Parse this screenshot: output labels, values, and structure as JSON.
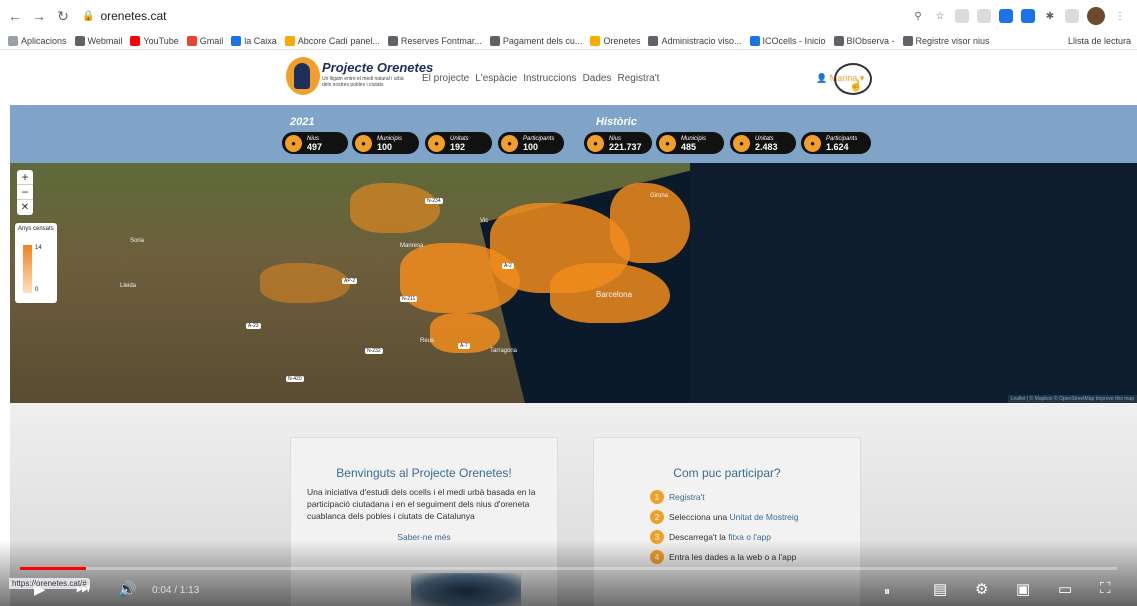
{
  "browser": {
    "url": "orenetes.cat",
    "bookmarks": [
      "Aplicacions",
      "Webmail",
      "YouTube",
      "Gmail",
      "la Caixa",
      "Abcore Cadí panel...",
      "Reserves Fontmar...",
      "Pagament dels cu...",
      "Orenetes",
      "Administracio viso...",
      "ICOcells - Inicio",
      "BIObserva -",
      "Registre visor nius"
    ],
    "reading_list": "Llista de lectura"
  },
  "site": {
    "logo_title": "Projecte Orenetes",
    "logo_subtitle": "Un lligam entre el medi natural i urbà dels nostres pobles i ciutats",
    "nav": [
      "El projecte",
      "L'espàcie",
      "Instruccions",
      "Dades",
      "Registra't"
    ],
    "user": "Marina"
  },
  "stats": {
    "year_label": "2021",
    "history_label": "Històric",
    "current": [
      {
        "label": "Nius",
        "value": "497",
        "icon": "bird-icon"
      },
      {
        "label": "Municipis",
        "value": "100",
        "icon": "building-icon"
      },
      {
        "label": "Unitats",
        "value": "192",
        "icon": "square-icon"
      },
      {
        "label": "Participants",
        "value": "100",
        "icon": "people-icon"
      }
    ],
    "historic": [
      {
        "label": "Nius",
        "value": "221.737",
        "icon": "bird-icon"
      },
      {
        "label": "Municipis",
        "value": "485",
        "icon": "building-icon"
      },
      {
        "label": "Unitats",
        "value": "2.483",
        "icon": "square-icon"
      },
      {
        "label": "Participants",
        "value": "1.624",
        "icon": "people-icon"
      }
    ]
  },
  "map": {
    "zoom_in": "+",
    "zoom_out": "−",
    "legend_title": "Anys censats",
    "legend_max": "14",
    "legend_min": "0",
    "city_label": "Barcelona",
    "place_labels": [
      "Tarragona",
      "Lleida",
      "Girona",
      "Vic",
      "Manresa",
      "Reus",
      "Soria"
    ],
    "road_labels": [
      "N-234",
      "A-2",
      "AP-2",
      "N-232",
      "A-23",
      "N-211",
      "A-7",
      "N-420"
    ],
    "attribution": "Leaflet | © Mapbox © OpenStreetMap Improve this map"
  },
  "welcome_card": {
    "title": "Benvinguts al Projecte Orenetes!",
    "text": "Una iniciativa d'estudi dels ocells i el medi urbà basada en la participació ciutadana i en el seguiment dels nius d'oreneta cuablanca dels pobles i ciutats de Catalunya",
    "link": "Saber-ne més"
  },
  "participate_card": {
    "title": "Com puc participar?",
    "steps": [
      {
        "num": "1",
        "pre": "",
        "link": "Registra't",
        "post": ""
      },
      {
        "num": "2",
        "pre": "Selecciona una ",
        "link": "Unitat de Mostreig",
        "post": ""
      },
      {
        "num": "3",
        "pre": "Descarrega't la ",
        "link": "fitxa o l'app",
        "post": ""
      },
      {
        "num": "4",
        "pre": "Entra les dades a la web o a l'app",
        "link": "",
        "post": ""
      }
    ]
  },
  "player": {
    "time": "0:04 / 1:13",
    "played_fraction": 0.06,
    "status_url": "https://orenetes.cat/#"
  }
}
